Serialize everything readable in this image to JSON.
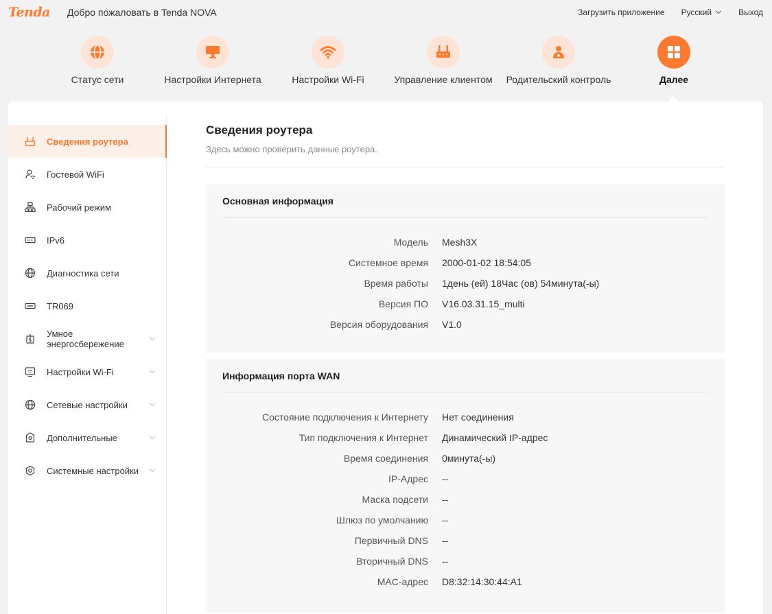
{
  "header": {
    "logo": "Tenda",
    "welcome": "Добро пожаловать в Tenda NOVA",
    "download_app": "Загрузить приложение",
    "language": "Русский",
    "logout": "Выход"
  },
  "nav": [
    {
      "label": "Статус сети",
      "icon": "globe-icon"
    },
    {
      "label": "Настройки Интернета",
      "icon": "monitor-icon"
    },
    {
      "label": "Настройки Wi-Fi",
      "icon": "wifi-icon"
    },
    {
      "label": "Управление клиентом",
      "icon": "router-icon"
    },
    {
      "label": "Родительский контроль",
      "icon": "parent-icon"
    },
    {
      "label": "Далее",
      "icon": "grid-icon",
      "active": true
    }
  ],
  "sidebar": [
    {
      "label": "Сведения роутера",
      "icon": "router-icon",
      "active": true
    },
    {
      "label": "Гостевой WiFi",
      "icon": "guest-wifi-icon"
    },
    {
      "label": "Рабочий режим",
      "icon": "network-mode-icon"
    },
    {
      "label": "IPv6",
      "icon": "ipv6-icon"
    },
    {
      "label": "Диагностика сети",
      "icon": "globe-icon"
    },
    {
      "label": "TR069",
      "icon": "tr069-icon"
    },
    {
      "label": "Умное энергосбережение",
      "icon": "power-save-icon",
      "expandable": true
    },
    {
      "label": "Настройки Wi-Fi",
      "icon": "wifi-settings-icon",
      "expandable": true
    },
    {
      "label": "Сетевые настройки",
      "icon": "globe-icon",
      "expandable": true
    },
    {
      "label": "Дополнительные",
      "icon": "advanced-icon",
      "expandable": true
    },
    {
      "label": "Системные настройки",
      "icon": "system-icon",
      "expandable": true
    }
  ],
  "content": {
    "title": "Сведения роутера",
    "subtitle": "Здесь можно проверить данные роутера.",
    "basic": {
      "title": "Основная информация",
      "rows": [
        {
          "label": "Модель",
          "value": "Mesh3X"
        },
        {
          "label": "Системное время",
          "value": "2000-01-02 18:54:05"
        },
        {
          "label": "Время работы",
          "value": "1день (ей) 18Час (ов) 54минута(-ы)"
        },
        {
          "label": "Версия ПО",
          "value": "V16.03.31.15_multi"
        },
        {
          "label": "Версия оборудования",
          "value": "V1.0"
        }
      ]
    },
    "wan": {
      "title": "Информация порта WAN",
      "rows": [
        {
          "label": "Состояние подключения к Интернету",
          "value": "Нет соединения"
        },
        {
          "label": "Тип подключения к Интернет",
          "value": "Динамический IP-адрес"
        },
        {
          "label": "Время соединения",
          "value": "0минута(-ы)"
        },
        {
          "label": "IP-Адрес",
          "value": "--"
        },
        {
          "label": "Маска подсети",
          "value": "--"
        },
        {
          "label": "Шлюз по умолчанию",
          "value": "--"
        },
        {
          "label": "Первичный DNS",
          "value": "--"
        },
        {
          "label": "Вторичный DNS",
          "value": "--"
        },
        {
          "label": "MAC-адрес",
          "value": "D8:32:14:30:44:A1"
        }
      ]
    }
  },
  "colors": {
    "accent": "#ff7a2f",
    "accent_light": "#fde4d6"
  }
}
